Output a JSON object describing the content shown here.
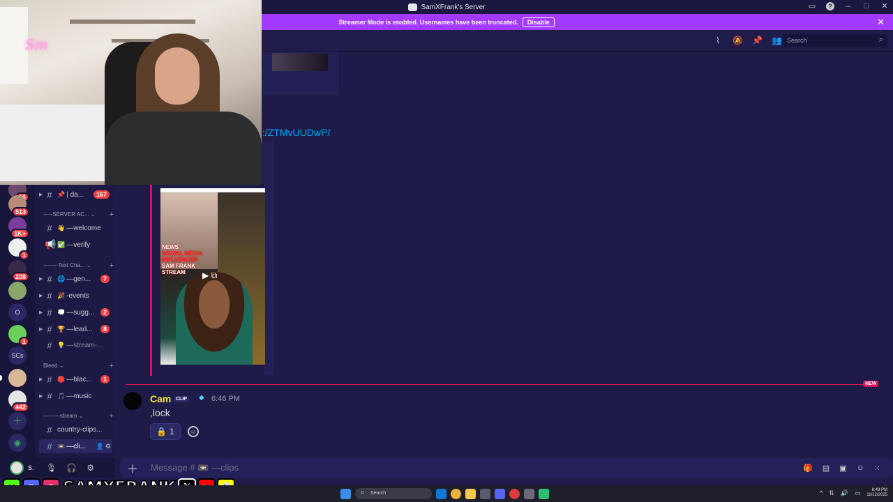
{
  "window": {
    "title": "SamXFrank's Server"
  },
  "banner": {
    "text": "Streamer Mode is enabled. Usernames have been truncated.",
    "disable_label": "Disable"
  },
  "header": {
    "search_placeholder": "Search"
  },
  "webcam": {
    "neon_text": "Sm"
  },
  "servers": [
    {
      "badge": "16"
    },
    {
      "badge": "513"
    },
    {
      "badge": "1K+"
    },
    {
      "badge": "1"
    },
    {
      "badge": "208"
    },
    {
      "badge": ""
    },
    {
      "label": "O"
    },
    {
      "badge": "1"
    },
    {
      "label": "SCs"
    },
    {
      "badge": ""
    },
    {
      "badge": "442"
    }
  ],
  "channels": {
    "pinned": {
      "emoji": "📌",
      "name": "| da...",
      "count": "167"
    },
    "cat_server": "-----SERVER AC... ⌄",
    "welcome": {
      "emoji": "👋",
      "name": "—welcome"
    },
    "verify": {
      "emoji": "✅",
      "name": "—verify"
    },
    "cat_text": "--------Text Cha... ⌄",
    "general": {
      "emoji": "🌐",
      "name": "—gen...",
      "count": "7"
    },
    "events": {
      "emoji": "🎉",
      "name": "-events"
    },
    "suggestions": {
      "emoji": "💭",
      "name": "—sugg...",
      "count": "2"
    },
    "leaderboard": {
      "emoji": "🏆",
      "name": "—lead...",
      "count": "8"
    },
    "stream": {
      "emoji": "💡",
      "name": "—stream-..."
    },
    "cat_bleed": "Bleed ⌄",
    "blacklist": {
      "emoji": "🔴",
      "name": "—blac...",
      "count": "1"
    },
    "music": {
      "emoji": "🎵",
      "name": "—music"
    },
    "cat_stream": "---------stream ⌄",
    "country": {
      "name": "country-clips..."
    },
    "clips": {
      "emoji": "📼",
      "name": "—cli..."
    }
  },
  "user": {
    "name": "S."
  },
  "chat": {
    "link_text": "⁠:/ZTMvUUDwP/",
    "video_text": {
      "tag": "NEWS",
      "headline1": "SAM FRANK",
      "headline2": "STREAM",
      "sub": "SOCIAL MEDIA INFLUENCER"
    },
    "new_label": "NEW",
    "message": {
      "author": "Cam",
      "tag": "CLIP",
      "time": "6:46 PM",
      "text": ",lock",
      "reaction_emoji": "🔒",
      "reaction_count": "1"
    }
  },
  "composer": {
    "placeholder": "Message # 📼 —clips"
  },
  "overlay": {
    "brand": "SAMXFRANK"
  },
  "taskbar": {
    "search": "Search",
    "time": "6:49 PM",
    "date": "11/12/2025"
  },
  "colors": {
    "accent": "#a33bff",
    "unread": "#d4145a",
    "badge": "#f23f43",
    "link": "#00a8fc",
    "author": "#f5e82f"
  }
}
